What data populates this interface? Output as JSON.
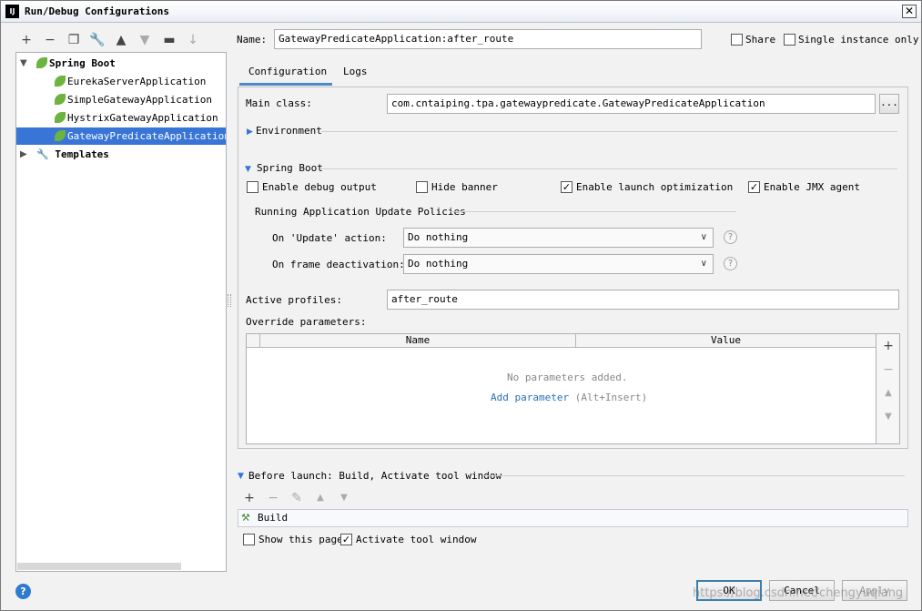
{
  "window": {
    "title": "Run/Debug Configurations",
    "icon_text": "IJ",
    "close_glyph": "✕"
  },
  "toolbar": {
    "icons": [
      "add-icon",
      "remove-icon",
      "copy-icon",
      "wrench-icon",
      "move-up-icon",
      "move-down-icon",
      "folder-icon",
      "sort-icon"
    ]
  },
  "tree": {
    "spring_boot": "Spring Boot",
    "items": [
      "EurekaServerApplication",
      "SimpleGatewayApplication",
      "HystrixGatewayApplication",
      "GatewayPredicateApplication:a"
    ],
    "templates": "Templates"
  },
  "form": {
    "name_label": "Name:",
    "name_value": "GatewayPredicateApplication:after_route",
    "share_label": "Share",
    "single_instance_label": "Single instance only"
  },
  "tabs": [
    "Configuration",
    "Logs"
  ],
  "config": {
    "main_class_label": "Main class:",
    "main_class_value": "com.cntaiping.tpa.gatewaypredicate.GatewayPredicateApplication",
    "browse_label": "...",
    "environment_label": "Environment",
    "spring_boot_label": "Spring Boot",
    "enable_debug_label": "Enable debug output",
    "hide_banner_label": "Hide banner",
    "enable_launch_label": "Enable launch optimization",
    "enable_jmx_label": "Enable JMX agent",
    "policies_label": "Running Application Update Policies",
    "update_action_label": "On 'Update' action:",
    "update_action_value": "Do nothing",
    "frame_deactivation_label": "On frame deactivation:",
    "frame_deactivation_value": "Do nothing",
    "active_profiles_label": "Active profiles:",
    "active_profiles_value": "after_route",
    "override_label": "Override parameters:",
    "col_name": "Name",
    "col_value": "Value",
    "no_params": "No parameters added.",
    "add_param": "Add parameter",
    "add_param_shortcut": "(Alt+Insert)"
  },
  "before_launch": {
    "label": "Before launch: Build, Activate tool window",
    "build_item": "Build",
    "show_page_label": "Show this page",
    "activate_label": "Activate tool window"
  },
  "checked": {
    "share": false,
    "single_instance": false,
    "debug": false,
    "banner": false,
    "launch": true,
    "jmx": true,
    "show_page": false,
    "activate": true
  },
  "buttons": {
    "ok": "OK",
    "cancel": "Cancel",
    "apply": "Apply"
  },
  "watermark": "https://blog.csdn.net/chengyuqiang"
}
